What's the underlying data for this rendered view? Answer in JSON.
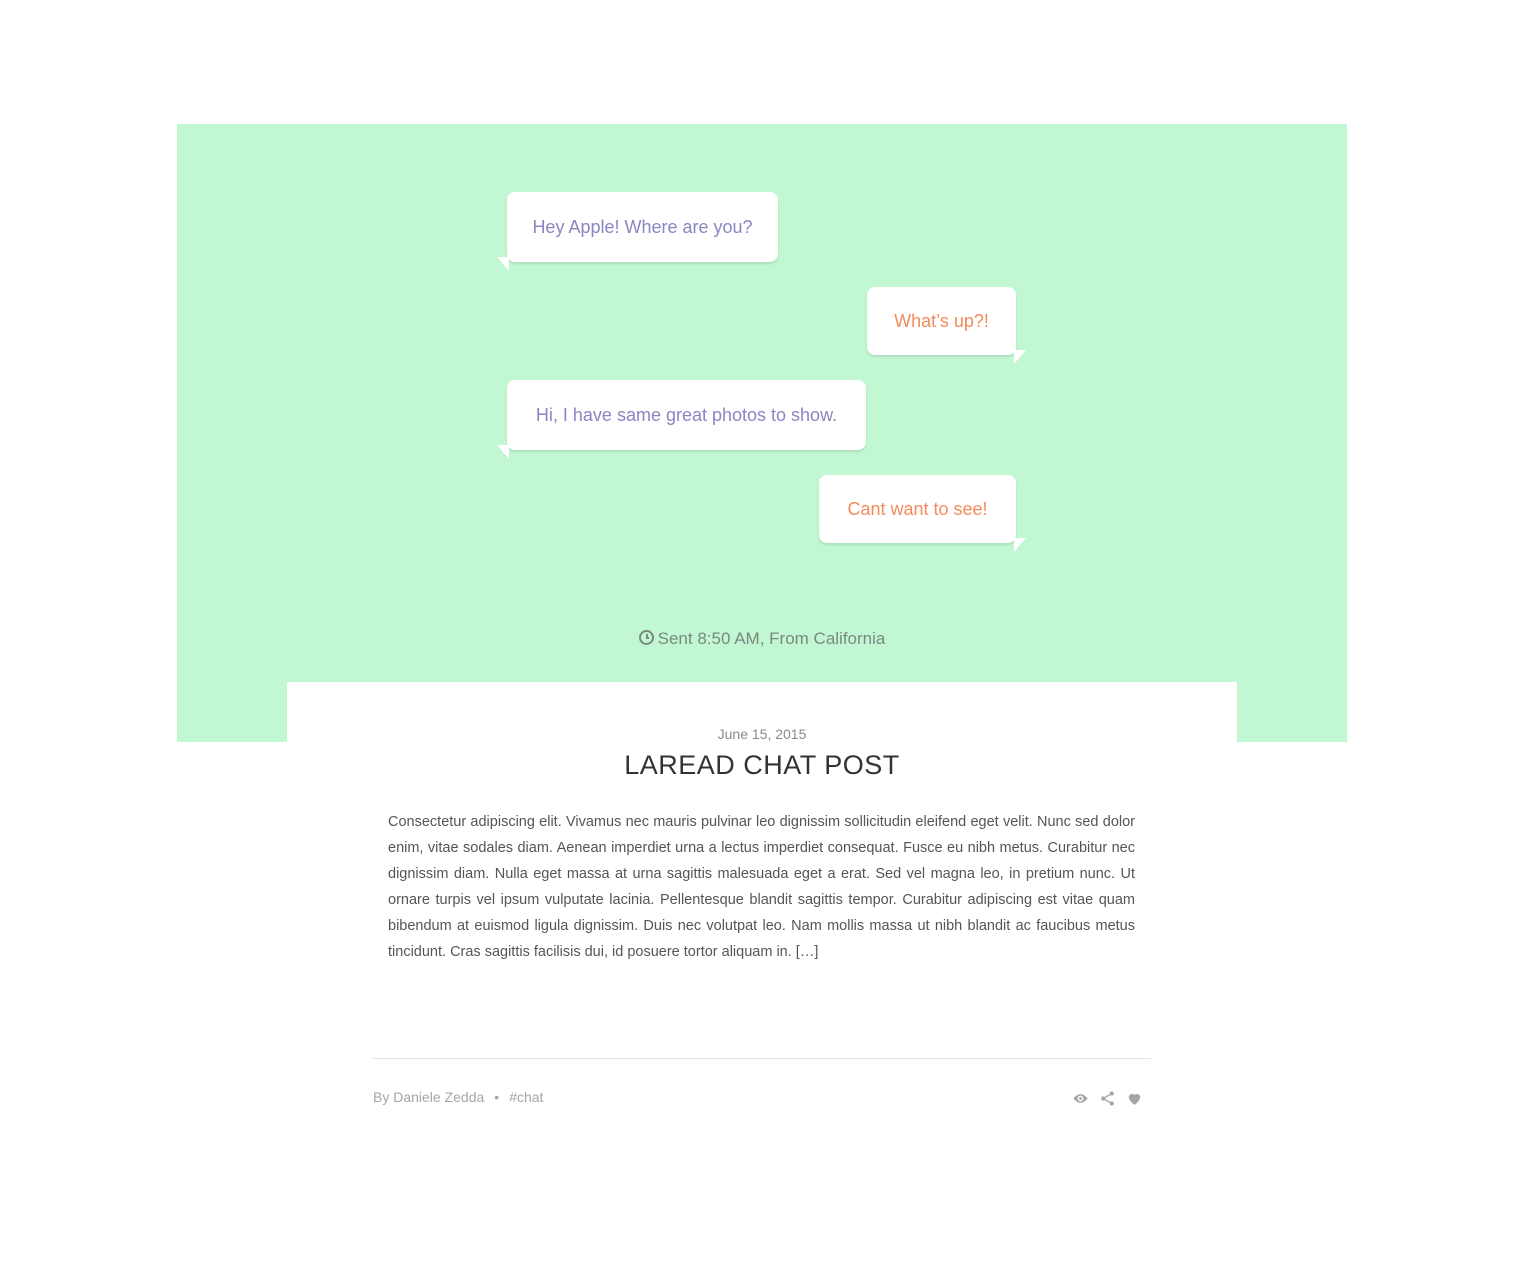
{
  "chat": {
    "messages": [
      {
        "side": "left",
        "text": "Hey Apple! Where are you?"
      },
      {
        "side": "right",
        "text": "What’s up?!"
      },
      {
        "side": "left",
        "text": "Hi, I have same great photos to show."
      },
      {
        "side": "right",
        "text": "Cant want to see!"
      }
    ],
    "sent_info": "Sent 8:50 AM, From California",
    "clock_icon": "clock-icon"
  },
  "post": {
    "date": "June 15, 2015",
    "title": "LAREAD CHAT POST",
    "body": "Consectetur adipiscing elit. Vivamus nec mauris pulvinar leo dignissim sollicitudin eleifend eget velit. Nunc sed dolor enim, vitae sodales diam. Aenean imperdiet urna a lectus imperdiet consequat. Fusce eu nibh metus. Curabitur nec dignissim diam. Nulla eget massa at urna sagittis malesuada eget a erat. Sed vel magna leo, in pretium nunc. Ut ornare turpis vel ipsum vulputate lacinia. Pellentesque blandit sagittis tempor. Curabitur adipiscing est vitae quam bibendum at euismod ligula dignissim. Duis nec volutpat leo. Nam mollis massa ut nibh blandit ac faucibus metus tincidunt. Cras sagittis facilisis dui, id posuere tortor aliquam in. […]",
    "author": "By Daniele Zedda",
    "separator": "•",
    "tag": "#chat",
    "action_icons": [
      "eye-icon",
      "share-icon",
      "heart-icon"
    ]
  },
  "colors": {
    "hero_bg": "#c1f7d3",
    "left_bubble_text": "#8a86c2",
    "right_bubble_text": "#f58a5b"
  }
}
